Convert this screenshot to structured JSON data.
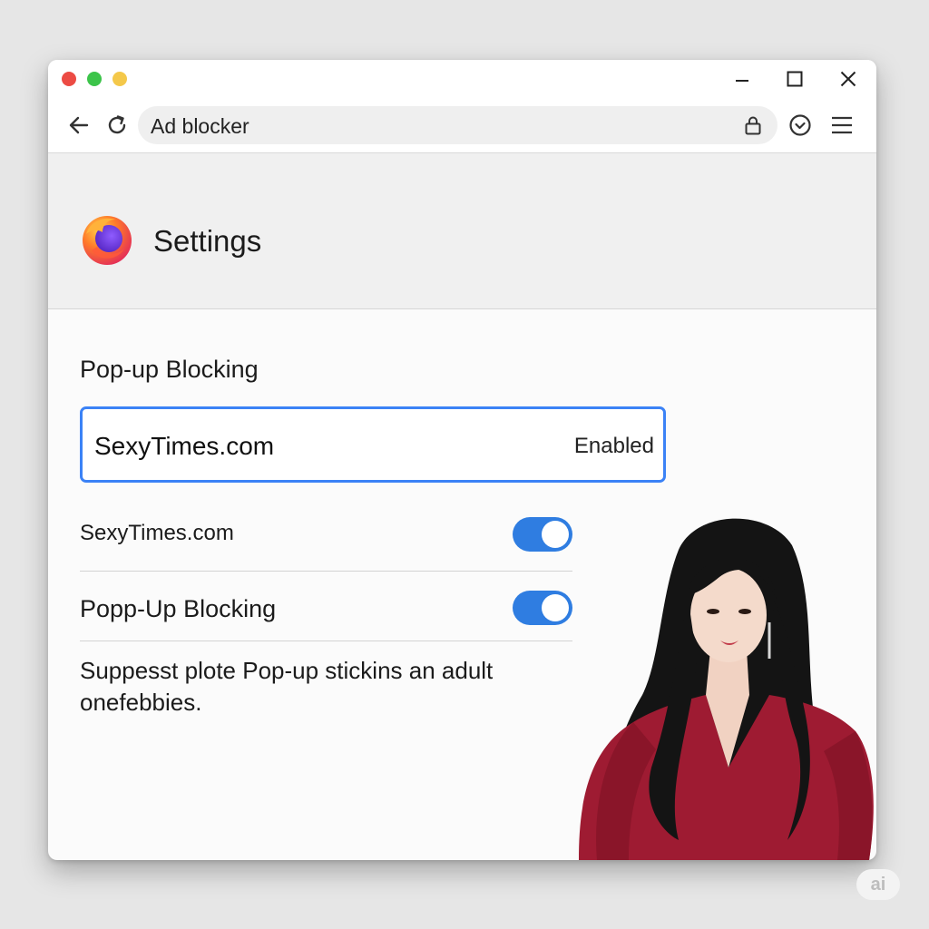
{
  "window": {
    "controls": {
      "close_color": "#ec4b44",
      "minimize_color": "#3cc44a",
      "zoom_color": "#f4c84a",
      "min_icon": "minimize-icon",
      "max_icon": "maximize-icon",
      "close_icon": "close-icon"
    }
  },
  "toolbar": {
    "back_icon": "back-arrow-icon",
    "reload_icon": "reload-icon",
    "address_value": "Ad blocker",
    "lock_icon": "lock-icon",
    "extension_icon": "check-circle-icon",
    "menu_icon": "hamburger-menu-icon"
  },
  "header": {
    "logo_icon": "firefox-logo-icon",
    "title": "Settings"
  },
  "content": {
    "section_title": "Pop-up Blocking",
    "site_box": {
      "name": "SexyTimes.com",
      "status": "Enabled"
    },
    "rows": [
      {
        "label": "SexyTimes.com",
        "enabled": true
      },
      {
        "label": "Popp-Up Blocking",
        "enabled": true
      }
    ],
    "description": "Suppesst plote Pop-up stickins an adult onefebbies."
  },
  "colors": {
    "accent": "#2f7de1",
    "focus_border": "#3b82f6",
    "dress": "#9e1b32"
  },
  "watermark": "ai"
}
